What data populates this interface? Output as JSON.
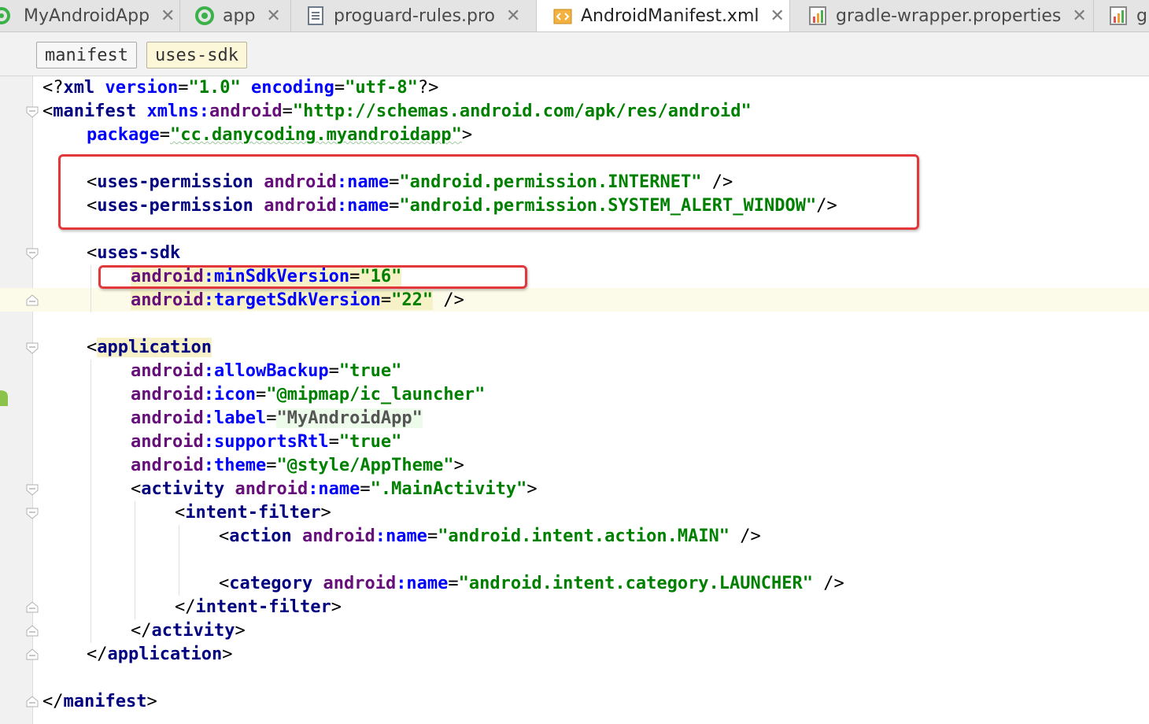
{
  "tabs": [
    {
      "label": "MyAndroidApp",
      "close": "✕",
      "icon": "android-module-icon"
    },
    {
      "label": "app",
      "close": "✕",
      "icon": "android-module-icon"
    },
    {
      "label": "proguard-rules.pro",
      "close": "✕",
      "icon": "text-file-icon"
    },
    {
      "label": "AndroidManifest.xml",
      "close": "✕",
      "icon": "xml-file-icon",
      "active": true
    },
    {
      "label": "gradle-wrapper.properties",
      "close": "✕",
      "icon": "properties-file-icon"
    },
    {
      "label": "g",
      "icon": "properties-file-icon"
    }
  ],
  "breadcrumb": [
    "manifest",
    "uses-sdk"
  ],
  "code": {
    "l1": {
      "p1": "<?",
      "t": "xml",
      "a1": " version",
      "p2": "=",
      "v1": "\"1.0\"",
      "a2": " encoding",
      "p3": "=",
      "v2": "\"utf-8\"",
      "p4": "?>"
    },
    "l2": {
      "p1": "<",
      "t": "manifest",
      "a": " xmlns:",
      "ns": "android",
      "p2": "=",
      "v": "\"http://schemas.android.com/apk/res/android\""
    },
    "l3": {
      "a": "package",
      "p1": "=",
      "v": "\"cc.danycoding.myandroidapp\"",
      "p2": ">"
    },
    "l5": {
      "p1": "<",
      "t": "uses-permission",
      "ns": "android",
      "a": ":name",
      "p2": "=",
      "v": "\"android.permission.INTERNET\"",
      "p3": " />"
    },
    "l6": {
      "p1": "<",
      "t": "uses-permission",
      "ns": "android",
      "a": ":name",
      "p2": "=",
      "v": "\"android.permission.SYSTEM_ALERT_WINDOW\"",
      "p3": "/>"
    },
    "l8": {
      "p1": "<",
      "t": "uses-sdk"
    },
    "l9": {
      "ns": "android",
      "a": ":minSdkVersion",
      "p1": "=",
      "v": "\"16\""
    },
    "l10": {
      "ns": "android",
      "a": ":targetSdkVersion",
      "p1": "=",
      "v": "\"22\"",
      "p2": " />"
    },
    "l12": {
      "p1": "<",
      "t": "application"
    },
    "l13": {
      "ns": "android",
      "a": ":allowBackup",
      "p1": "=",
      "v": "\"true\""
    },
    "l14": {
      "ns": "android",
      "a": ":icon",
      "p1": "=",
      "v": "\"@mipmap/ic_launcher\""
    },
    "l15": {
      "ns": "android",
      "a": ":label",
      "p1": "=",
      "v": "\"MyAndroidApp\""
    },
    "l16": {
      "ns": "android",
      "a": ":supportsRtl",
      "p1": "=",
      "v": "\"true\""
    },
    "l17": {
      "ns": "android",
      "a": ":theme",
      "p1": "=",
      "v": "\"@style/AppTheme\"",
      "p2": ">"
    },
    "l18": {
      "p1": "<",
      "t": "activity",
      "ns": "android",
      "a": ":name",
      "p2": "=",
      "v": "\".MainActivity\"",
      "p3": ">"
    },
    "l19": {
      "p1": "<",
      "t": "intent-filter",
      "p2": ">"
    },
    "l20": {
      "p1": "<",
      "t": "action",
      "ns": "android",
      "a": ":name",
      "p2": "=",
      "v": "\"android.intent.action.MAIN\"",
      "p3": " />"
    },
    "l22": {
      "p1": "<",
      "t": "category",
      "ns": "android",
      "a": ":name",
      "p2": "=",
      "v": "\"android.intent.category.LAUNCHER\"",
      "p3": " />"
    },
    "l23": {
      "p1": "</",
      "t": "intent-filter",
      "p2": ">"
    },
    "l24": {
      "p1": "</",
      "t": "activity",
      "p2": ">"
    },
    "l25": {
      "p1": "</",
      "t": "application",
      "p2": ">"
    },
    "l27": {
      "p1": "</",
      "t": "manifest",
      "p2": ">"
    }
  },
  "colors": {
    "highlight_box": "#e2383b",
    "tag": "#000080",
    "value": "#008000",
    "namespace": "#660e7a",
    "attribute": "#0000ff"
  }
}
